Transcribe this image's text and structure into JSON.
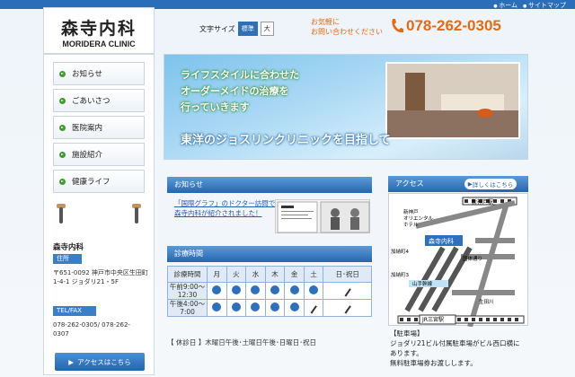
{
  "topnav": {
    "items": [
      "ホーム",
      "サイトマップ"
    ]
  },
  "logo": {
    "jp": "森寺内科",
    "en": "MORIDERA CLINIC"
  },
  "fontsize": {
    "label": "文字サイズ",
    "standard": "標準",
    "large": "大"
  },
  "contact": {
    "line1": "お気軽に",
    "line2": "お問い合わせください",
    "phone": "078-262-0305"
  },
  "sidebar": {
    "items": [
      {
        "label": "お知らせ"
      },
      {
        "label": "ごあいさつ"
      },
      {
        "label": "医院案内"
      },
      {
        "label": "施設紹介"
      },
      {
        "label": "健康ライフ"
      }
    ],
    "clinic_name": "森寺内科",
    "address_tag": "住所",
    "address": "〒651-0092 神戸市中央区生田町1-4-1 ジョダリ21・5F",
    "tel_tag": "TEL/FAX",
    "tel": "078-262-0305/ 078-262-0307",
    "access_button": "アクセスはこちら"
  },
  "hero": {
    "line1": "ライフスタイルに合わせた",
    "line2": "オーダーメイドの治療を",
    "line3": "行っていきます",
    "main": "東洋のジョスリンクリニックを目指して"
  },
  "news": {
    "title": "お知らせ",
    "item": "「国際グラフ」のドクター訪問で森寺内科が紹介されました！"
  },
  "hours": {
    "title": "診療時間",
    "headers": [
      "診療時間",
      "月",
      "火",
      "水",
      "木",
      "金",
      "土",
      "日･祝日"
    ],
    "rows": [
      {
        "time": "午前9:00〜12:30",
        "marks": [
          "open",
          "open",
          "open",
          "open",
          "open",
          "open",
          "closed"
        ]
      },
      {
        "time": "午後4:00〜7:00",
        "marks": [
          "open",
          "open",
          "open",
          "open",
          "open",
          "closed",
          "closed"
        ]
      }
    ],
    "holiday": "【 休診日 】木曜日午後･土曜日午後･日曜日･祝日"
  },
  "access": {
    "title": "アクセス",
    "detail_button": "詳しくはこちら",
    "map_labels": {
      "station1": "新神戸駅",
      "hotel": "新神戸 オリエンタル ホテル",
      "clinic": "森寺内科",
      "kanocho4": "加納町4",
      "kokutai": "国体通り",
      "kanocho3": "加納町3",
      "yamate": "山手幹線",
      "ikutagawa": "生田川",
      "station2": "JR三宮駅"
    },
    "parking_title": "【駐車場】",
    "parking_text": "ジョダリ21ビル付属駐車場がビル西口横にあります。",
    "parking_text2": "無料駐車場券お渡しします。"
  }
}
